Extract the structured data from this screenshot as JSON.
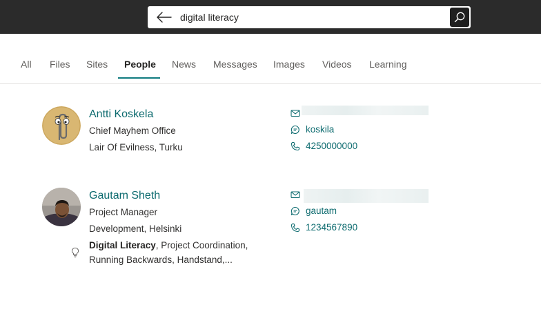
{
  "search": {
    "query": "digital literacy"
  },
  "tabs": [
    {
      "label": "All"
    },
    {
      "label": "Files"
    },
    {
      "label": "Sites"
    },
    {
      "label": "People"
    },
    {
      "label": "News"
    },
    {
      "label": "Messages"
    },
    {
      "label": "Images"
    },
    {
      "label": "Videos"
    },
    {
      "label": "Learning"
    }
  ],
  "active_tab": "People",
  "colors": {
    "accent": "#0f7b7f",
    "link": "#0d6b6f",
    "topbar": "#2b2b2b"
  },
  "people": [
    {
      "name": "Antti Koskela",
      "title": "Chief Mayhem Office",
      "location": "Lair Of Evilness, Turku",
      "chat": "koskila",
      "phone": "4250000000",
      "avatar": "clippy-avatar"
    },
    {
      "name": "Gautam Sheth",
      "title": "Project Manager",
      "location": "Development, Helsinki",
      "skills_highlight": "Digital Literacy",
      "skills_rest": ", Project Coordination,",
      "skills_line2": "Running Backwards, Handstand,...",
      "chat": "gautam",
      "phone": "1234567890",
      "avatar": "photo-avatar"
    }
  ],
  "icons": {
    "back": "arrow-left-icon",
    "search": "search-icon",
    "email": "mail-icon",
    "chat": "chat-icon",
    "phone": "phone-icon",
    "skills": "lightbulb-icon"
  }
}
